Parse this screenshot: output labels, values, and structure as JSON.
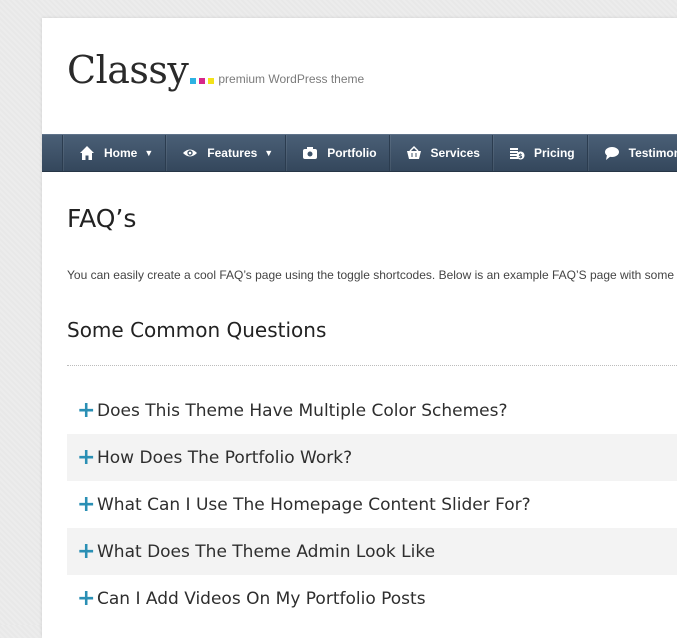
{
  "brand": {
    "name": "Classy",
    "tagline": "premium WordPress theme",
    "dot_colors": [
      "#2db2e2",
      "#d7268a",
      "#f3e21a"
    ]
  },
  "nav": {
    "items": [
      {
        "label": "Home",
        "icon": "home-icon",
        "dropdown": true
      },
      {
        "label": "Features",
        "icon": "eye-icon",
        "dropdown": true
      },
      {
        "label": "Portfolio",
        "icon": "camera-icon",
        "dropdown": false
      },
      {
        "label": "Services",
        "icon": "basket-icon",
        "dropdown": false
      },
      {
        "label": "Pricing",
        "icon": "coins-icon",
        "dropdown": false
      },
      {
        "label": "Testimon",
        "icon": "speech-bubble-icon",
        "dropdown": false
      }
    ]
  },
  "page": {
    "title": "FAQ’s",
    "intro": "You can easily create a cool FAQ’s page using the toggle shortcodes. Below is an example FAQ’S page with some",
    "section_heading": "Some Common Questions"
  },
  "faq": {
    "toggle_symbol": "+",
    "items": [
      "Does This Theme Have Multiple Color Schemes?",
      "How Does The Portfolio Work?",
      "What Can I Use The Homepage Content Slider For?",
      "What Does The Theme Admin Look Like",
      "Can I Add Videos On My Portfolio Posts"
    ]
  },
  "colors": {
    "nav_bg": "#3e5369",
    "accent": "#2a8fb4"
  }
}
